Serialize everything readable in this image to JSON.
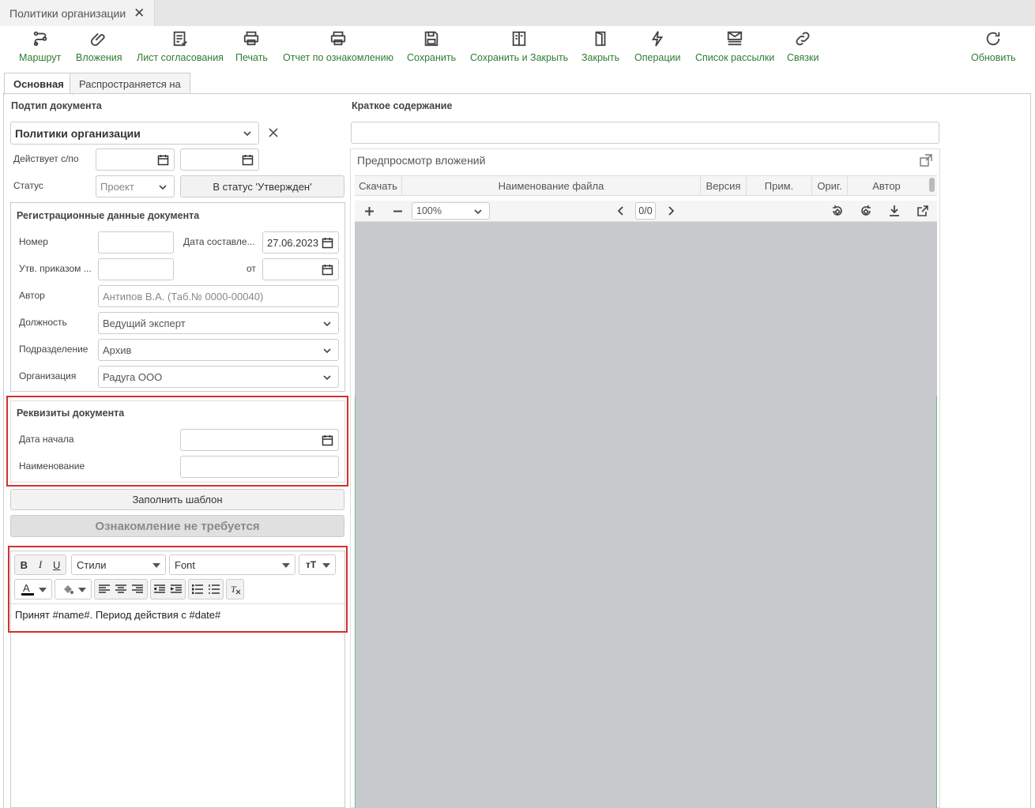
{
  "window_tab": {
    "title": "Политики организации",
    "close": "✕"
  },
  "toolbar": [
    {
      "label": "Маршрут",
      "icon": "route-icon"
    },
    {
      "label": "Вложения",
      "icon": "paperclip-icon"
    },
    {
      "label": "Лист согласования",
      "icon": "approval-sheet-icon"
    },
    {
      "label": "Печать",
      "icon": "printer-icon"
    },
    {
      "label": "Отчет по ознакомлению",
      "icon": "printer-icon"
    },
    {
      "label": "Сохранить",
      "icon": "save-icon"
    },
    {
      "label": "Сохранить и Закрыть",
      "icon": "save-close-icon"
    },
    {
      "label": "Закрыть",
      "icon": "door-icon"
    },
    {
      "label": "Операции",
      "icon": "lightning-icon"
    },
    {
      "label": "Список рассылки",
      "icon": "mail-list-icon"
    },
    {
      "label": "Связки",
      "icon": "link-icon"
    },
    {
      "label": "Обновить",
      "icon": "refresh-icon"
    }
  ],
  "form_tabs": [
    "Основная",
    "Распространяется на"
  ],
  "left": {
    "subtype_label": "Подтип документа",
    "subtype_value": "Политики организации",
    "valid_label": "Действует с/по",
    "status_label": "Статус",
    "status_value": "Проект",
    "status_button": "В статус 'Утвержден'"
  },
  "registration": {
    "title": "Регистрационные данные документа",
    "number_label": "Номер",
    "number_value": "",
    "date_label": "Дата составле...",
    "date_value": "27.06.2023",
    "order_label": "Утв. приказом ...",
    "from_label": "от",
    "author_label": "Автор",
    "author_value": "Антипов В.А. (Таб.№ 0000-00040)",
    "position_label": "Должность",
    "position_value": "Ведущий эксперт",
    "department_label": "Подразделение",
    "department_value": "Архив",
    "organization_label": "Организация",
    "organization_value": "Радуга ООО"
  },
  "requisites": {
    "title": "Реквизиты документа",
    "start_date_label": "Дата начала",
    "name_label": "Наименование"
  },
  "fill_template_button": "Заполнить шаблон",
  "acquaintance_button": "Ознакомление не требуется",
  "editor": {
    "styles": "Стили",
    "font": "Font",
    "size_icon": "ᴛT",
    "content": "Принят #name#. Период действия с #date#"
  },
  "right": {
    "summary_label": "Краткое содержание",
    "preview_title": "Предпросмотр вложений",
    "columns": [
      "Скачать",
      "Наименование файла",
      "Версия",
      "Прим.",
      "Ориг.",
      "Автор"
    ],
    "zoom": "100%",
    "page": "0/0"
  },
  "colors": {
    "accent": "#2e7d32",
    "highlight": "#d32f2f",
    "viewer_bg": "#c8c9cd"
  }
}
